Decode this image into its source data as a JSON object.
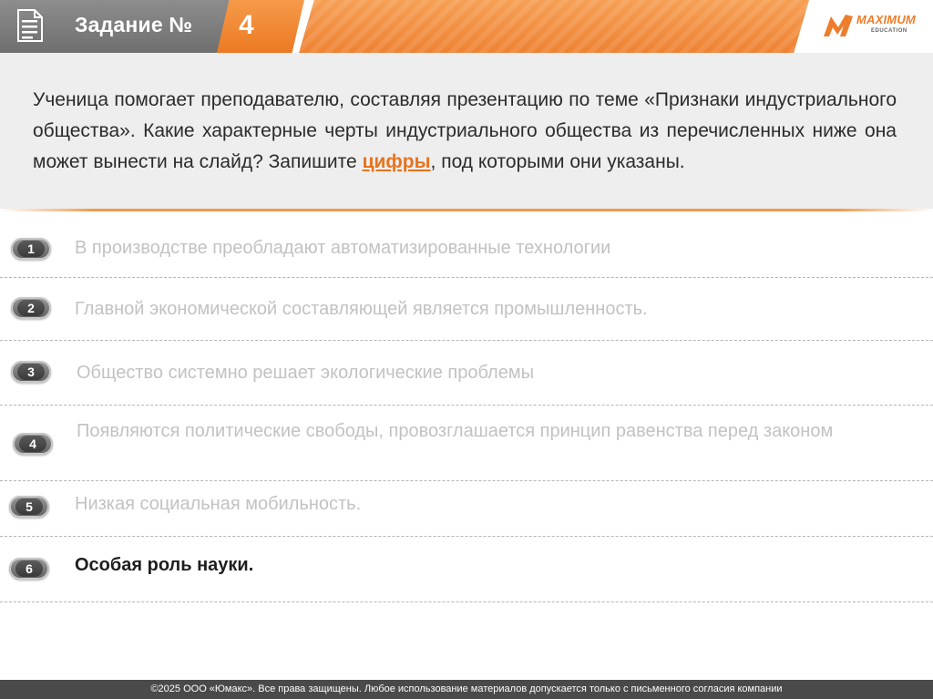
{
  "header": {
    "task_label": "Задание №",
    "task_number": "4",
    "logo_name": "MAXIMUM",
    "logo_sub": "EDUCATION"
  },
  "question": {
    "text_before": "Ученица помогает преподавателю, составляя презентацию по теме «Признаки индустриального общества». Какие характерные черты индустриального общества из перечисленных ниже она может вынести на слайд? Запишите ",
    "highlight": "цифры",
    "text_after": ", под которыми они указаны."
  },
  "options": [
    {
      "number": "1",
      "text": "В производстве преобладают автоматизированные технологии"
    },
    {
      "number": "2",
      "text": "Главной экономической составляющей является промышленность."
    },
    {
      "number": "3",
      "text": "Общество системно решает экологические проблемы"
    },
    {
      "number": "4",
      "text": "Появляются политические свободы, провозглашается принцип равенства перед законом"
    },
    {
      "number": "5",
      "text": "Низкая социальная мобильность."
    },
    {
      "number": "6",
      "text": "Особая роль науки."
    }
  ],
  "footer": {
    "text": "©2025 ООО «Юмакс». Все права защищены. Любое использование материалов допускается только с письменного согласия компании"
  },
  "colors": {
    "accent": "#ee7d2b",
    "header_gray": "#7d7d7d",
    "question_bg": "#eeeeee",
    "footer_bg": "#4a4a4a"
  },
  "icons": {
    "document": "document-icon",
    "logo": "maximum-logo-icon"
  }
}
